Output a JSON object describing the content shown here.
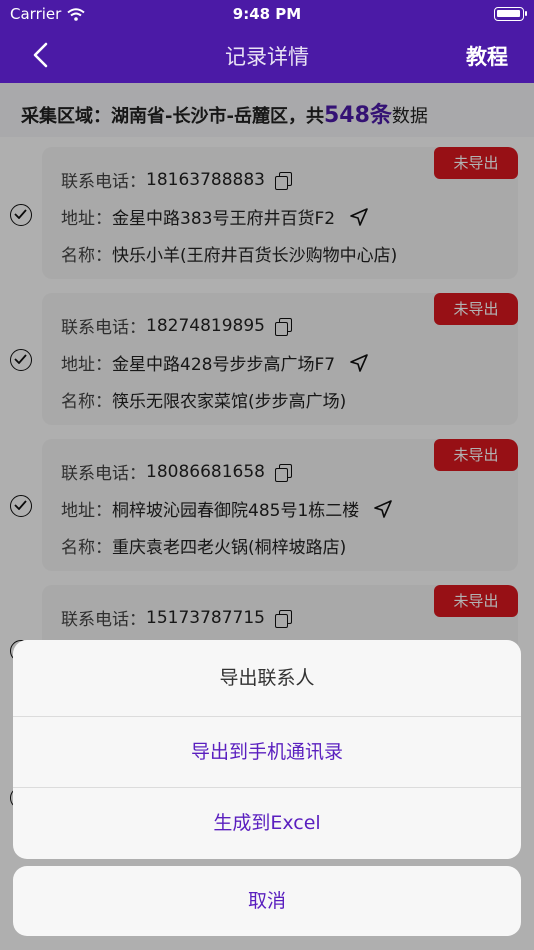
{
  "status_bar": {
    "carrier": "Carrier",
    "time": "9:48 PM"
  },
  "nav": {
    "title": "记录详情",
    "right_action": "教程"
  },
  "region": {
    "prefix": "采集区域：湖南省-长沙市-岳麓区，共",
    "count": "548条",
    "suffix": "数据"
  },
  "labels": {
    "phone": "联系电话：",
    "address": "地址：",
    "name": "名称："
  },
  "records": [
    {
      "phone": "18163788883",
      "address": "金星中路383号王府井百货F2",
      "name": "快乐小羊(王府井百货长沙购物中心店)",
      "status": "未导出"
    },
    {
      "phone": "18274819895",
      "address": "金星中路428号步步高广场F7",
      "name": "筷乐无限农家菜馆(步步高广场)",
      "status": "未导出"
    },
    {
      "phone": "18086681658",
      "address": "桐梓坡沁园春御院485号1栋二楼",
      "name": "重庆袁老四老火锅(桐梓坡路店)",
      "status": "未导出"
    },
    {
      "phone": "15173787715",
      "status": "未导出"
    }
  ],
  "action_sheet": {
    "title": "导出联系人",
    "options": [
      "导出到手机通讯录",
      "生成到Excel"
    ],
    "cancel": "取消"
  },
  "colors": {
    "primary": "#4b1aa6",
    "badge": "#d8171f",
    "action": "#5a1fbf"
  }
}
